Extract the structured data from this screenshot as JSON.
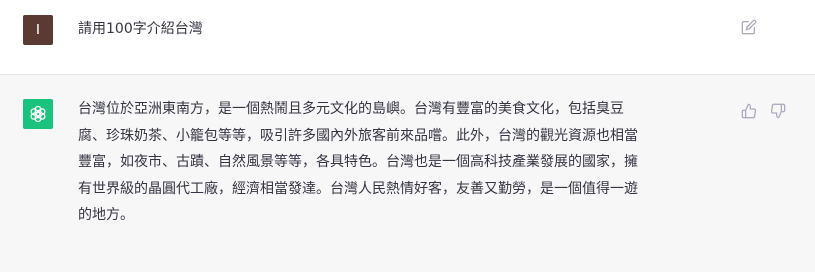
{
  "conversation": {
    "user_message": {
      "avatar_letter": "I",
      "avatar_color": "#5a3a32",
      "text": "請用100字介紹台灣",
      "edit_icon": "edit-icon"
    },
    "assistant_message": {
      "avatar_icon": "openai-logo-icon",
      "avatar_color": "#19c37d",
      "text": "台灣位於亞洲東南方，是一個熱鬧且多元文化的島嶼。台灣有豐富的美食文化，包括臭豆\n腐、珍珠奶茶、小籠包等等，吸引許多國內外旅客前來品嚐。此外，台灣的觀光資源也相當\n豐富，如夜市、古蹟、自然風景等等，各具特色。台灣也是一個高科技產業發展的國家，擁\n有世界級的晶圓代工廠，經濟相當發達。台灣人民熱情好客，友善又勤勞，是一個值得一遊\n的地方。",
      "actions": [
        "thumbs-up-icon",
        "thumbs-down-icon"
      ]
    }
  },
  "colors": {
    "assistant_background": "#f7f7f8",
    "text": "#343541",
    "icon": "#acacbe"
  }
}
